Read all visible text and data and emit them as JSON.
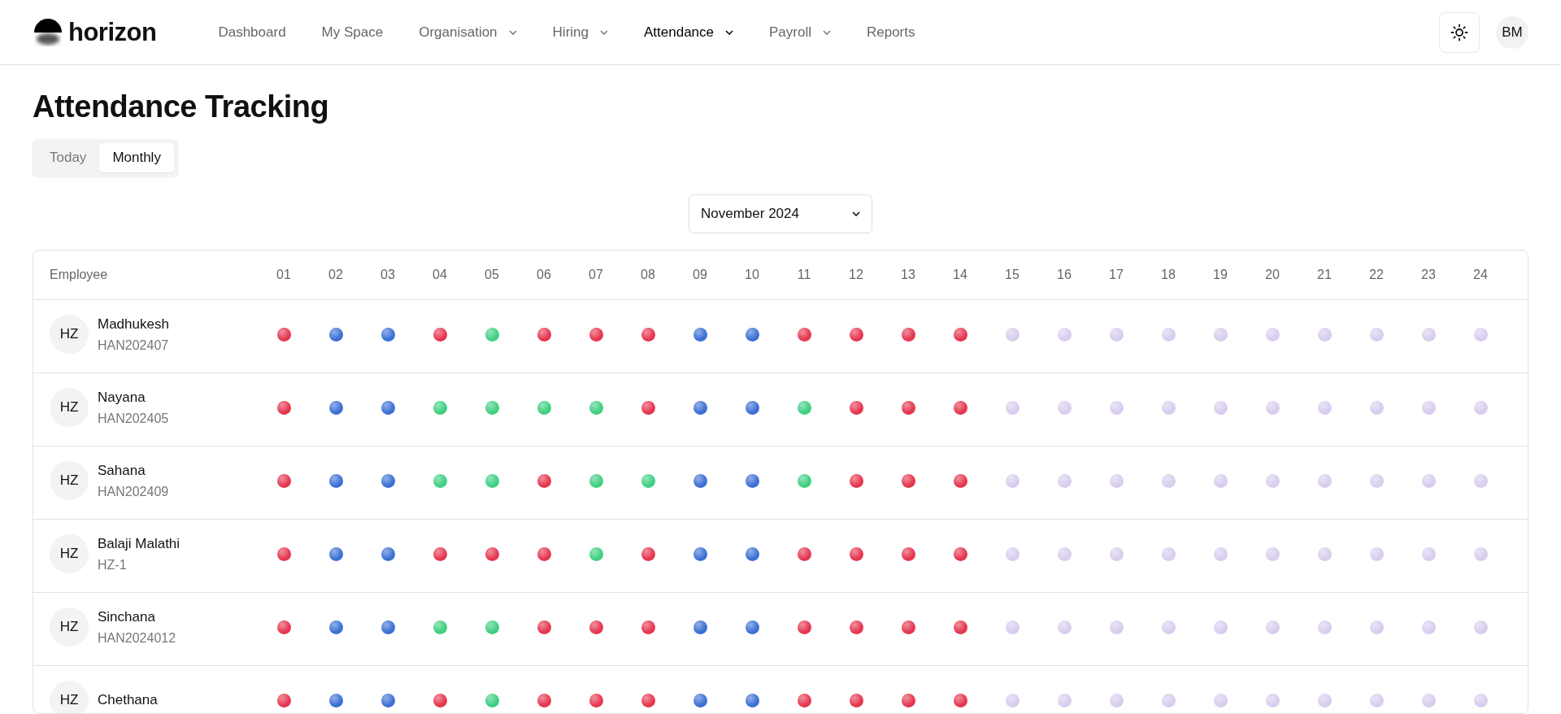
{
  "header": {
    "logo": "horizon",
    "nav": [
      {
        "label": "Dashboard",
        "selected": false,
        "has_menu": false
      },
      {
        "label": "My Space",
        "selected": false,
        "has_menu": false
      },
      {
        "label": "Organisation",
        "selected": false,
        "has_menu": true
      },
      {
        "label": "Hiring",
        "selected": false,
        "has_menu": true
      },
      {
        "label": "Attendance",
        "selected": true,
        "has_menu": true
      },
      {
        "label": "Payroll",
        "selected": false,
        "has_menu": true
      },
      {
        "label": "Reports",
        "selected": false,
        "has_menu": false
      }
    ],
    "avatar": "BM"
  },
  "title": "Attendance Tracking",
  "tabs": [
    {
      "label": "Today",
      "selected": false
    },
    {
      "label": "Monthly",
      "selected": true
    }
  ],
  "month_select": {
    "value": "November 2024"
  },
  "table": {
    "columns": [
      "Employee",
      "01",
      "02",
      "03",
      "04",
      "05",
      "06",
      "07",
      "08",
      "09",
      "10",
      "11",
      "12",
      "13",
      "14",
      "15",
      "16",
      "17",
      "18",
      "19",
      "20",
      "21",
      "22",
      "23",
      "24"
    ],
    "rows": [
      {
        "avatar": "HZ",
        "name": "Madhukesh",
        "id": "HAN202407",
        "days": [
          {
            "color": "#e5354f"
          },
          {
            "color": "#3b6fd4"
          },
          {
            "color": "#3b6fd4"
          },
          {
            "color": "#e5354f"
          },
          {
            "color": "#3ecf80"
          },
          {
            "color": "#e5354f"
          },
          {
            "color": "#e5354f"
          },
          {
            "color": "#e5354f"
          },
          {
            "color": "#3b6fd4"
          },
          {
            "color": "#3b6fd4"
          },
          {
            "color": "#e5354f"
          },
          {
            "color": "#e5354f"
          },
          {
            "color": "#e5354f"
          },
          {
            "color": "#e5354f"
          },
          {
            "color": "#d8cdee"
          },
          {
            "color": "#d8cdee"
          },
          {
            "color": "#d8cdee"
          },
          {
            "color": "#d8cdee"
          },
          {
            "color": "#d8cdee"
          },
          {
            "color": "#d8cdee"
          },
          {
            "color": "#d8cdee"
          },
          {
            "color": "#d8cdee"
          },
          {
            "color": "#d8cdee"
          },
          {
            "color": "#d8cdee"
          }
        ]
      },
      {
        "avatar": "HZ",
        "name": "Nayana",
        "id": "HAN202405",
        "days": [
          {
            "color": "#e5354f"
          },
          {
            "color": "#3b6fd4"
          },
          {
            "color": "#3b6fd4"
          },
          {
            "color": "#3ecf80"
          },
          {
            "color": "#3ecf80"
          },
          {
            "color": "#3ecf80"
          },
          {
            "color": "#3ecf80"
          },
          {
            "color": "#e5354f"
          },
          {
            "color": "#3b6fd4"
          },
          {
            "color": "#3b6fd4"
          },
          {
            "color": "#3ecf80"
          },
          {
            "color": "#e5354f"
          },
          {
            "color": "#e5354f"
          },
          {
            "color": "#e5354f"
          },
          {
            "color": "#d8cdee"
          },
          {
            "color": "#d8cdee"
          },
          {
            "color": "#d8cdee"
          },
          {
            "color": "#d8cdee"
          },
          {
            "color": "#d8cdee"
          },
          {
            "color": "#d8cdee"
          },
          {
            "color": "#d8cdee"
          },
          {
            "color": "#d8cdee"
          },
          {
            "color": "#d8cdee"
          },
          {
            "color": "#d8cdee"
          }
        ]
      },
      {
        "avatar": "HZ",
        "name": "Sahana",
        "id": "HAN202409",
        "days": [
          {
            "color": "#e5354f"
          },
          {
            "color": "#3b6fd4"
          },
          {
            "color": "#3b6fd4"
          },
          {
            "color": "#3ecf80"
          },
          {
            "color": "#3ecf80"
          },
          {
            "color": "#e5354f"
          },
          {
            "color": "#3ecf80"
          },
          {
            "color": "#3ecf80"
          },
          {
            "color": "#3b6fd4"
          },
          {
            "color": "#3b6fd4"
          },
          {
            "color": "#3ecf80"
          },
          {
            "color": "#e5354f"
          },
          {
            "color": "#e5354f"
          },
          {
            "color": "#e5354f"
          },
          {
            "color": "#d8cdee"
          },
          {
            "color": "#d8cdee"
          },
          {
            "color": "#d8cdee"
          },
          {
            "color": "#d8cdee"
          },
          {
            "color": "#d8cdee"
          },
          {
            "color": "#d8cdee"
          },
          {
            "color": "#d8cdee"
          },
          {
            "color": "#d8cdee"
          },
          {
            "color": "#d8cdee"
          },
          {
            "color": "#d8cdee"
          }
        ]
      },
      {
        "avatar": "HZ",
        "name": "Balaji Malathi",
        "id": "HZ-1",
        "days": [
          {
            "color": "#e5354f"
          },
          {
            "color": "#3b6fd4"
          },
          {
            "color": "#3b6fd4"
          },
          {
            "color": "#e5354f"
          },
          {
            "color": "#e5354f"
          },
          {
            "color": "#e5354f"
          },
          {
            "color": "#3ecf80"
          },
          {
            "color": "#e5354f"
          },
          {
            "color": "#3b6fd4"
          },
          {
            "color": "#3b6fd4"
          },
          {
            "color": "#e5354f"
          },
          {
            "color": "#e5354f"
          },
          {
            "color": "#e5354f"
          },
          {
            "color": "#e5354f"
          },
          {
            "color": "#d8cdee"
          },
          {
            "color": "#d8cdee"
          },
          {
            "color": "#d8cdee"
          },
          {
            "color": "#d8cdee"
          },
          {
            "color": "#d8cdee"
          },
          {
            "color": "#d8cdee"
          },
          {
            "color": "#d8cdee"
          },
          {
            "color": "#d8cdee"
          },
          {
            "color": "#d8cdee"
          },
          {
            "color": "#d8cdee"
          }
        ]
      },
      {
        "avatar": "HZ",
        "name": "Sinchana",
        "id": "HAN2024012",
        "days": [
          {
            "color": "#e5354f"
          },
          {
            "color": "#3b6fd4"
          },
          {
            "color": "#3b6fd4"
          },
          {
            "color": "#3ecf80"
          },
          {
            "color": "#3ecf80"
          },
          {
            "color": "#e5354f"
          },
          {
            "color": "#e5354f"
          },
          {
            "color": "#e5354f"
          },
          {
            "color": "#3b6fd4"
          },
          {
            "color": "#3b6fd4"
          },
          {
            "color": "#e5354f"
          },
          {
            "color": "#e5354f"
          },
          {
            "color": "#e5354f"
          },
          {
            "color": "#e5354f"
          },
          {
            "color": "#d8cdee"
          },
          {
            "color": "#d8cdee"
          },
          {
            "color": "#d8cdee"
          },
          {
            "color": "#d8cdee"
          },
          {
            "color": "#d8cdee"
          },
          {
            "color": "#d8cdee"
          },
          {
            "color": "#d8cdee"
          },
          {
            "color": "#d8cdee"
          },
          {
            "color": "#d8cdee"
          },
          {
            "color": "#d8cdee"
          }
        ]
      },
      {
        "avatar": "HZ",
        "name": "Chethana",
        "days": [
          {
            "color": "#e5354f"
          },
          {
            "color": "#3b6fd4"
          },
          {
            "color": "#3b6fd4"
          },
          {
            "color": "#e5354f"
          },
          {
            "color": "#3ecf80"
          },
          {
            "color": "#e5354f"
          },
          {
            "color": "#e5354f"
          },
          {
            "color": "#e5354f"
          },
          {
            "color": "#3b6fd4"
          },
          {
            "color": "#3b6fd4"
          },
          {
            "color": "#e5354f"
          },
          {
            "color": "#e5354f"
          },
          {
            "color": "#e5354f"
          },
          {
            "color": "#e5354f"
          },
          {
            "color": "#d8cdee"
          },
          {
            "color": "#d8cdee"
          },
          {
            "color": "#d8cdee"
          },
          {
            "color": "#d8cdee"
          },
          {
            "color": "#d8cdee"
          },
          {
            "color": "#d8cdee"
          },
          {
            "color": "#d8cdee"
          },
          {
            "color": "#d8cdee"
          },
          {
            "color": "#d8cdee"
          },
          {
            "color": "#d8cdee"
          }
        ]
      }
    ]
  }
}
